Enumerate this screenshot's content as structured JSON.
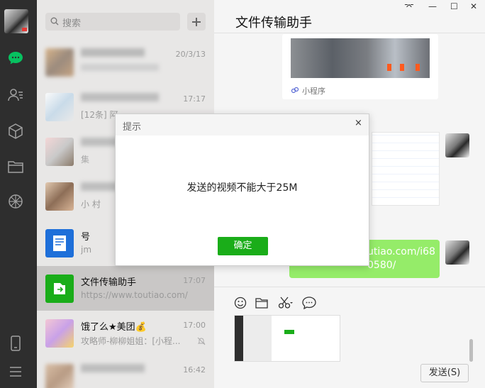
{
  "window": {
    "title": "文件传输助手",
    "controls": [
      "⌤",
      "—",
      "☐",
      "✕"
    ]
  },
  "search": {
    "placeholder": "搜索"
  },
  "chats": [
    {
      "name": "",
      "time": "20/3/13",
      "preview": ""
    },
    {
      "name": "",
      "time": "17:17",
      "preview": "[12条] 阿"
    },
    {
      "name": "",
      "time": "",
      "preview": "集"
    },
    {
      "name": "",
      "time": "",
      "preview": "小 村"
    },
    {
      "name": "号",
      "time": "",
      "preview": "jm"
    },
    {
      "name": "文件传输助手",
      "time": "17:07",
      "preview": "https://www.toutiao.com/"
    },
    {
      "name": "饿了么★美团💰",
      "time": "17:00",
      "preview": "攻略师-柳柳姐姐：[小程..."
    },
    {
      "name": "",
      "time": "16:42",
      "preview": ""
    }
  ],
  "messages": {
    "miniprogram_label": "小程序",
    "link_text": "utiao.com/i68\n0580/"
  },
  "composer": {
    "send_label": "发送(S)"
  },
  "dialog": {
    "title": "提示",
    "message": "发送的视频不能大于25M",
    "ok_label": "确定",
    "close": "×"
  },
  "colors": {
    "accent_green": "#1aad19",
    "bubble_green": "#95ec69",
    "sidebar": "#2e2e2e"
  }
}
